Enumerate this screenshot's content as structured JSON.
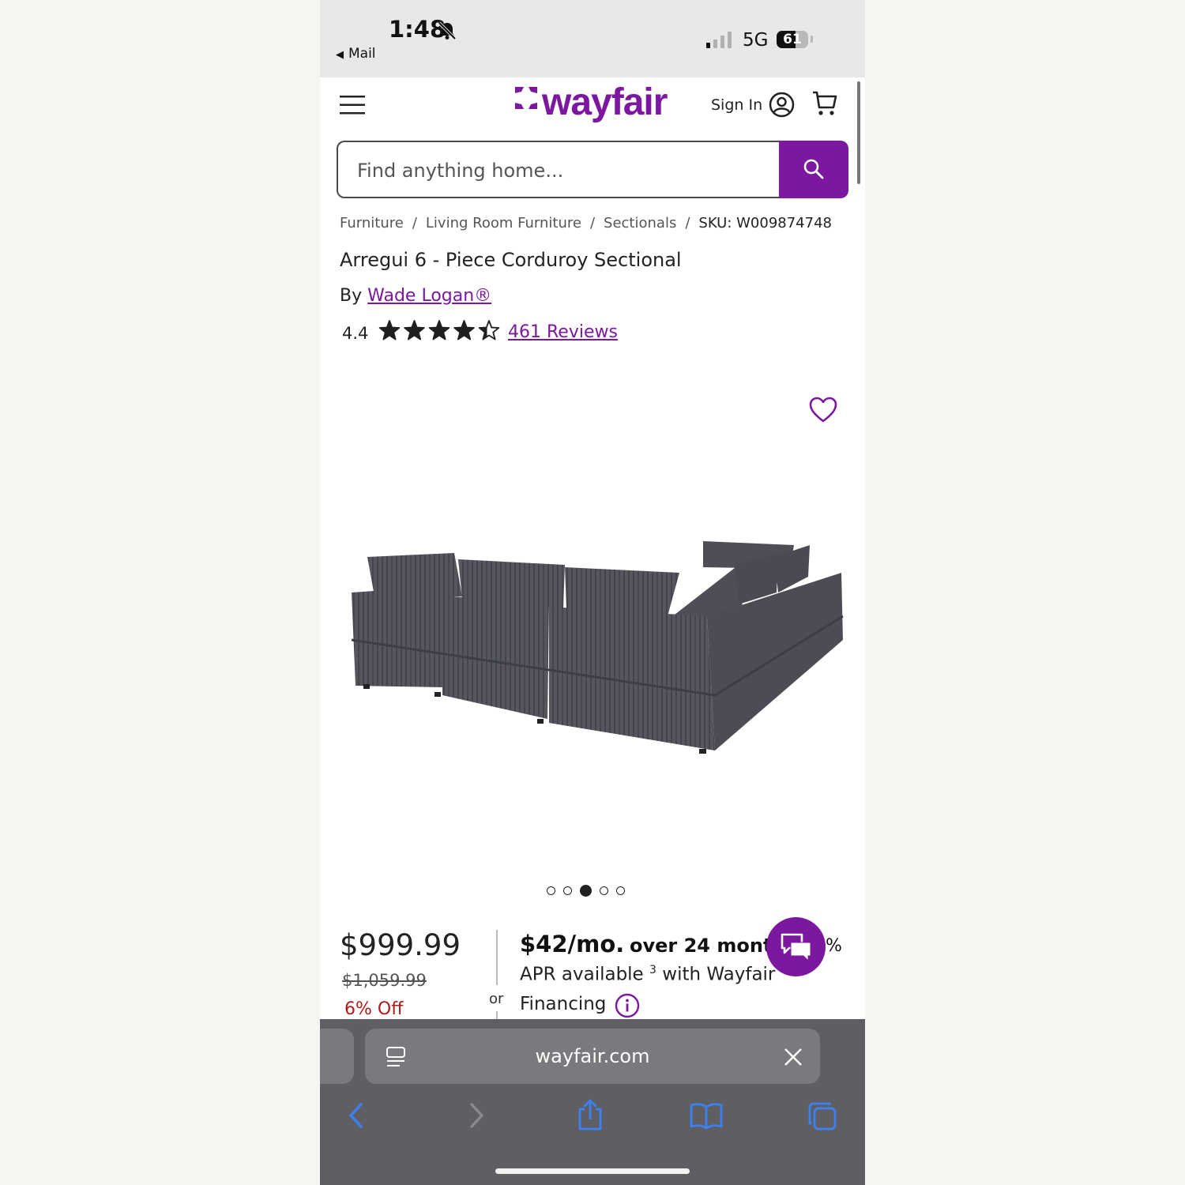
{
  "status_bar": {
    "time": "1:48",
    "back_app": "Mail",
    "network": "5G",
    "battery": "61",
    "battery_level": 0.61
  },
  "header": {
    "logo_text": "wayfair",
    "sign_in": "Sign In",
    "icons": [
      "menu-icon",
      "wayfair-logo-icon",
      "account-icon",
      "cart-icon"
    ]
  },
  "search": {
    "placeholder": "Find anything home..."
  },
  "breadcrumb": {
    "items": [
      "Furniture",
      "Living Room Furniture",
      "Sectionals"
    ],
    "sku": "SKU: W009874748",
    "separator": "/"
  },
  "product": {
    "title": "Arregui 6 - Piece Corduroy Sectional",
    "by_label": "By",
    "brand": "Wade Logan®",
    "rating": "4.4",
    "rating_stars": 4.4,
    "reviews": "461 Reviews",
    "image_count": 5,
    "active_image_index": 2
  },
  "pricing": {
    "price": "$999.99",
    "old_price": "$1,059.99",
    "discount": "6% Off",
    "or": "or",
    "monthly": "$42/mo.",
    "term": "over 24 montl",
    "pct_fragment": "%",
    "line2": "APR available",
    "footnote": "3",
    "line2_end": "with Wayfair",
    "line3": "Financing"
  },
  "browser": {
    "url": "wayfair.com",
    "icons": [
      "reader-icon",
      "close-icon",
      "back-icon",
      "forward-icon",
      "share-icon",
      "bookmarks-icon",
      "tabs-icon"
    ]
  },
  "colors": {
    "brand": "#7b189f",
    "discount": "#b21a1a",
    "toolbar": "#5f5e63"
  }
}
